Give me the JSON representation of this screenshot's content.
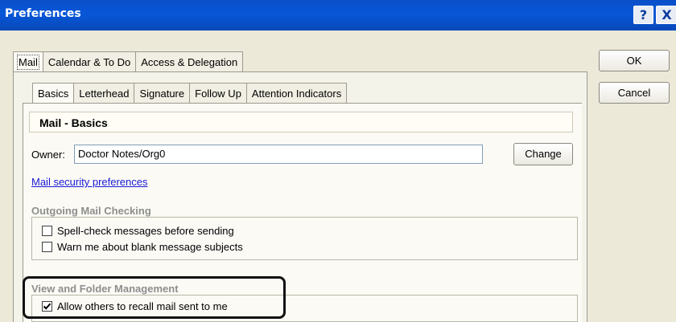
{
  "window": {
    "title": "Preferences",
    "help_label": "?",
    "close_label": "X"
  },
  "tabs": [
    {
      "label": "Mail",
      "active": true
    },
    {
      "label": "Calendar & To Do",
      "active": false
    },
    {
      "label": "Access & Delegation",
      "active": false
    }
  ],
  "subtabs": [
    {
      "label": "Basics",
      "active": true
    },
    {
      "label": "Letterhead",
      "active": false
    },
    {
      "label": "Signature",
      "active": false
    },
    {
      "label": "Follow Up",
      "active": false
    },
    {
      "label": "Attention Indicators",
      "active": false
    }
  ],
  "buttons": {
    "ok": "OK",
    "cancel": "Cancel",
    "change": "Change"
  },
  "section": {
    "title": "Mail - Basics"
  },
  "owner": {
    "label": "Owner:",
    "value": "Doctor Notes/Org0"
  },
  "security_link": "Mail security preferences",
  "outgoing": {
    "title": "Outgoing Mail Checking",
    "options": [
      {
        "label": "Spell-check messages before sending",
        "checked": false
      },
      {
        "label": "Warn me about blank message subjects",
        "checked": false
      }
    ]
  },
  "view_folder": {
    "title": "View and Folder Management",
    "options": [
      {
        "label": "Allow others to recall mail sent to me",
        "checked": true
      }
    ]
  },
  "colors": {
    "title_bar": "#0a4fc8",
    "link": "#1a1ad6",
    "group_title": "#8e8e8e",
    "dialog_bg": "#ece9d8"
  }
}
